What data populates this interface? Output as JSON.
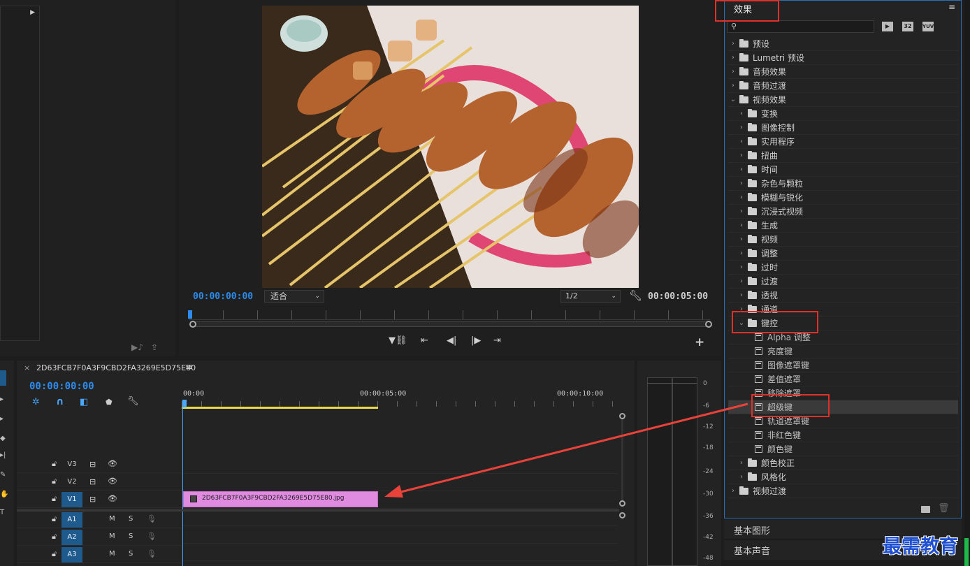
{
  "program_monitor": {
    "timecode_left": "00:00:00:00",
    "fit_select": "适合",
    "resolution_select": "1/2",
    "timecode_right": "00:00:05:00"
  },
  "timeline": {
    "sequence_name": "2D63FCB7F0A3F9CBD2FA3269E5D75E80",
    "timecode": "00:00:00:00",
    "ruler": [
      "00:00",
      "00:00:05:00",
      "00:00:10:00"
    ],
    "tracks": [
      {
        "name": "V3"
      },
      {
        "name": "V2"
      },
      {
        "name": "V1"
      },
      {
        "name": "A1",
        "m": "M",
        "s": "S"
      },
      {
        "name": "A2",
        "m": "M",
        "s": "S"
      },
      {
        "name": "A3",
        "m": "M",
        "s": "S"
      }
    ],
    "clip_name": "2D63FCB7F0A3F9CBD2FA3269E5D75E80.jpg",
    "clip_color": "#e08be0"
  },
  "meter": {
    "scale": [
      "0",
      "-6",
      "-12",
      "-18",
      "-24",
      "-30",
      "-36",
      "-42",
      "-48"
    ]
  },
  "effects": {
    "title": "效果",
    "badges": [
      "32",
      "YUV"
    ],
    "tree": [
      {
        "label": "预设",
        "level": 0,
        "icon": "preset-bin",
        "open": false
      },
      {
        "label": "Lumetri 预设",
        "level": 0,
        "icon": "preset-bin",
        "open": false
      },
      {
        "label": "音频效果",
        "level": 0,
        "icon": "folder",
        "open": false
      },
      {
        "label": "音频过渡",
        "level": 0,
        "icon": "folder",
        "open": false
      },
      {
        "label": "视频效果",
        "level": 0,
        "icon": "folder",
        "open": true
      },
      {
        "label": "变换",
        "level": 1,
        "icon": "folder",
        "open": false
      },
      {
        "label": "图像控制",
        "level": 1,
        "icon": "folder",
        "open": false
      },
      {
        "label": "实用程序",
        "level": 1,
        "icon": "folder",
        "open": false
      },
      {
        "label": "扭曲",
        "level": 1,
        "icon": "folder",
        "open": false
      },
      {
        "label": "时间",
        "level": 1,
        "icon": "folder",
        "open": false
      },
      {
        "label": "杂色与颗粒",
        "level": 1,
        "icon": "folder",
        "open": false
      },
      {
        "label": "模糊与锐化",
        "level": 1,
        "icon": "folder",
        "open": false
      },
      {
        "label": "沉浸式视频",
        "level": 1,
        "icon": "folder",
        "open": false
      },
      {
        "label": "生成",
        "level": 1,
        "icon": "folder",
        "open": false
      },
      {
        "label": "视频",
        "level": 1,
        "icon": "folder",
        "open": false
      },
      {
        "label": "调整",
        "level": 1,
        "icon": "folder",
        "open": false
      },
      {
        "label": "过时",
        "level": 1,
        "icon": "folder",
        "open": false
      },
      {
        "label": "过渡",
        "level": 1,
        "icon": "folder",
        "open": false
      },
      {
        "label": "透视",
        "level": 1,
        "icon": "folder",
        "open": false
      },
      {
        "label": "通道",
        "level": 1,
        "icon": "folder",
        "open": false
      },
      {
        "label": "键控",
        "level": 1,
        "icon": "folder",
        "open": true
      },
      {
        "label": "Alpha 调整",
        "level": 2,
        "icon": "effect"
      },
      {
        "label": "亮度键",
        "level": 2,
        "icon": "effect"
      },
      {
        "label": "图像遮罩键",
        "level": 2,
        "icon": "effect"
      },
      {
        "label": "差值遮罩",
        "level": 2,
        "icon": "effect"
      },
      {
        "label": "移除遮罩",
        "level": 2,
        "icon": "effect"
      },
      {
        "label": "超级键",
        "level": 2,
        "icon": "effect",
        "selected": true
      },
      {
        "label": "轨道遮罩键",
        "level": 2,
        "icon": "effect"
      },
      {
        "label": "非红色键",
        "level": 2,
        "icon": "effect"
      },
      {
        "label": "颜色键",
        "level": 2,
        "icon": "effect"
      },
      {
        "label": "颜色校正",
        "level": 1,
        "icon": "folder",
        "open": false
      },
      {
        "label": "风格化",
        "level": 1,
        "icon": "folder",
        "open": false
      },
      {
        "label": "视频过渡",
        "level": 0,
        "icon": "folder",
        "open": false
      }
    ]
  },
  "bottom_panels": [
    "基本图形",
    "基本声音"
  ],
  "watermark": "最需教育",
  "colors": {
    "accent": "#2d8ceb",
    "highlight_box": "#e0302a",
    "clip": "#e08be0",
    "playhead": "#4aa8ff"
  }
}
